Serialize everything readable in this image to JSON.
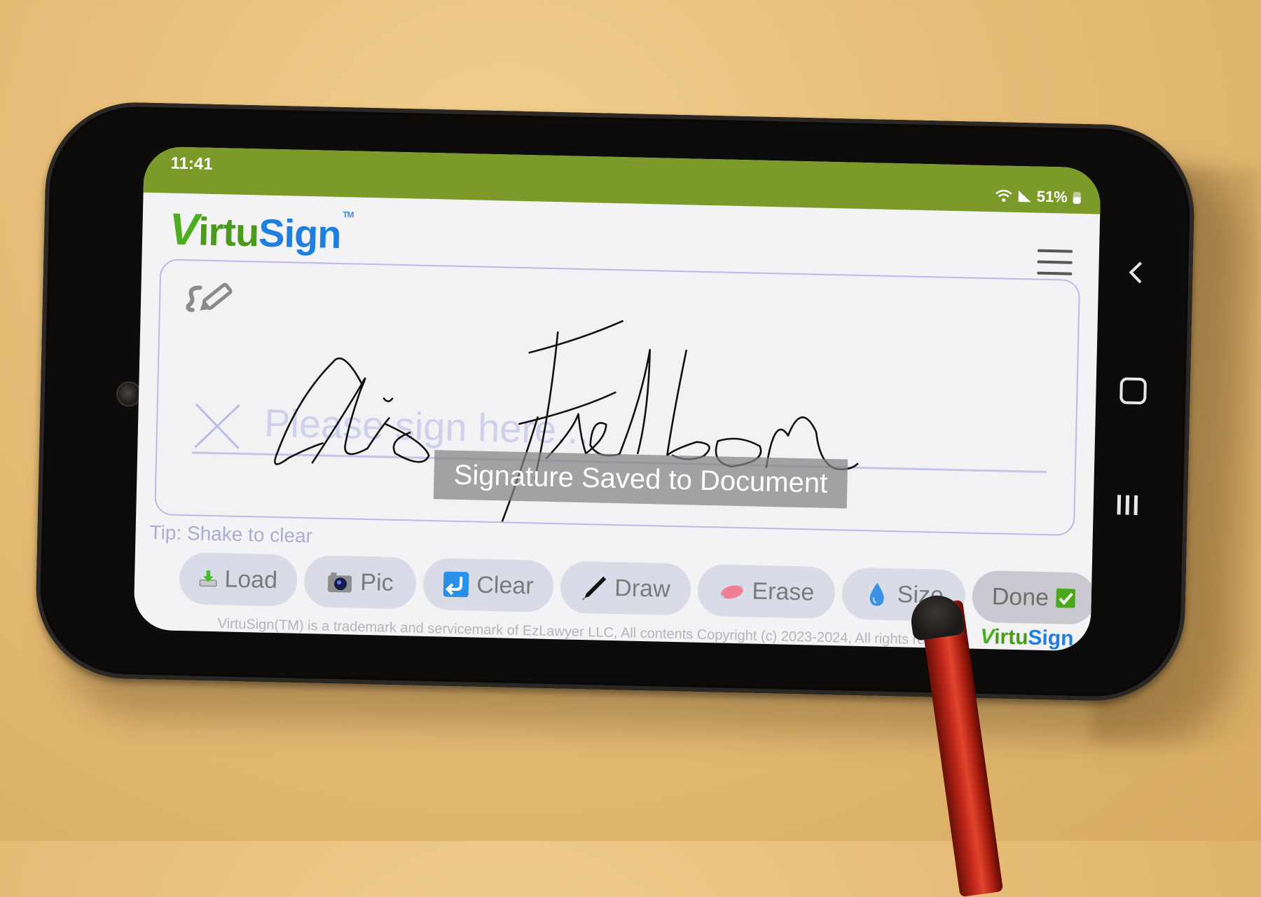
{
  "status_bar": {
    "time": "11:41",
    "battery": "51%",
    "icons": [
      "wifi-icon",
      "signal-icon",
      "battery-icon"
    ]
  },
  "app": {
    "logo": {
      "v": "V",
      "irtu": "irtu",
      "sign": "Sign",
      "tm": "TM"
    },
    "menu_icon": "hamburger-menu-icon"
  },
  "signature_pad": {
    "mode_icon": "signature-pen-icon",
    "placeholder": "Please sign here...",
    "sign_marker": "X",
    "signed_name": "Clio Frelbon",
    "toast": "Signature Saved to Document"
  },
  "tip": "Tip: Shake to clear",
  "toolbar": {
    "buttons": [
      {
        "label": "Load",
        "icon": "download-tray-icon"
      },
      {
        "label": "Pic",
        "icon": "camera-icon"
      },
      {
        "label": "Clear",
        "icon": "return-arrow-icon"
      },
      {
        "label": "Draw",
        "icon": "fountain-pen-icon"
      },
      {
        "label": "Erase",
        "icon": "eraser-icon"
      },
      {
        "label": "Size",
        "icon": "droplet-icon"
      },
      {
        "label": "Done",
        "icon": "check-box-icon"
      }
    ]
  },
  "footer": {
    "text": "VirtuSign(TM) is a trademark and servicemark of EzLawyer LLC, All contents Copyright (c) 2023-2024, All rights re",
    "logo": {
      "v": "V",
      "irtu": "irtu",
      "sign": "Sign"
    }
  },
  "nav_bar": {
    "back": "back-chevron-icon",
    "home": "home-square-icon",
    "recents": "recents-bars-icon"
  },
  "colors": {
    "status_bar": "#7c9a2a",
    "logo_green": "#4caf1f",
    "logo_blue": "#1f7fe0",
    "pad_border": "#b7bce3",
    "button_bg": "#d9dbe6",
    "toast_bg": "#828282"
  }
}
